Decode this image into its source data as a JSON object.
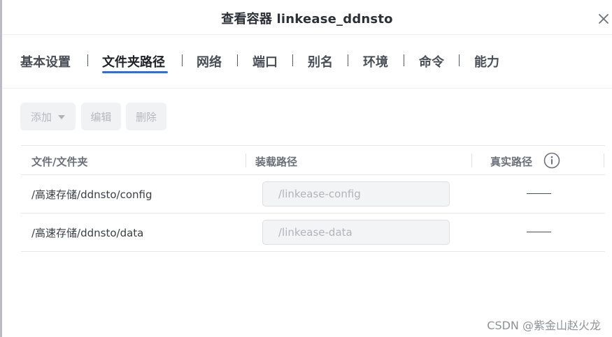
{
  "dialog": {
    "title": "查看容器 linkease_ddnsto"
  },
  "tabs": [
    {
      "label": "基本设置",
      "active": false
    },
    {
      "label": "文件夹路径",
      "active": true
    },
    {
      "label": "网络",
      "active": false
    },
    {
      "label": "端口",
      "active": false
    },
    {
      "label": "别名",
      "active": false
    },
    {
      "label": "环境",
      "active": false
    },
    {
      "label": "命令",
      "active": false
    },
    {
      "label": "能力",
      "active": false
    }
  ],
  "toolbar": {
    "add_label": "添加",
    "edit_label": "编辑",
    "delete_label": "删除"
  },
  "table": {
    "headers": [
      "文件/文件夹",
      "装载路径",
      "真实路径"
    ],
    "rows": [
      {
        "path": "/高速存储/ddnsto/config",
        "mount_placeholder": "/linkease-config",
        "real_path": "——"
      },
      {
        "path": "/高速存储/ddnsto/data",
        "mount_placeholder": "/linkease-data",
        "real_path": "——"
      }
    ]
  },
  "watermark": "CSDN @紫金山赵火龙",
  "colors": {
    "accent": "#3b6ad6",
    "disabled_button_bg": "#f1f2f4",
    "disabled_text": "#b4b8be"
  },
  "icons": {
    "close": "close-icon",
    "dropdown": "chevron-down-icon",
    "info": "info-icon"
  }
}
